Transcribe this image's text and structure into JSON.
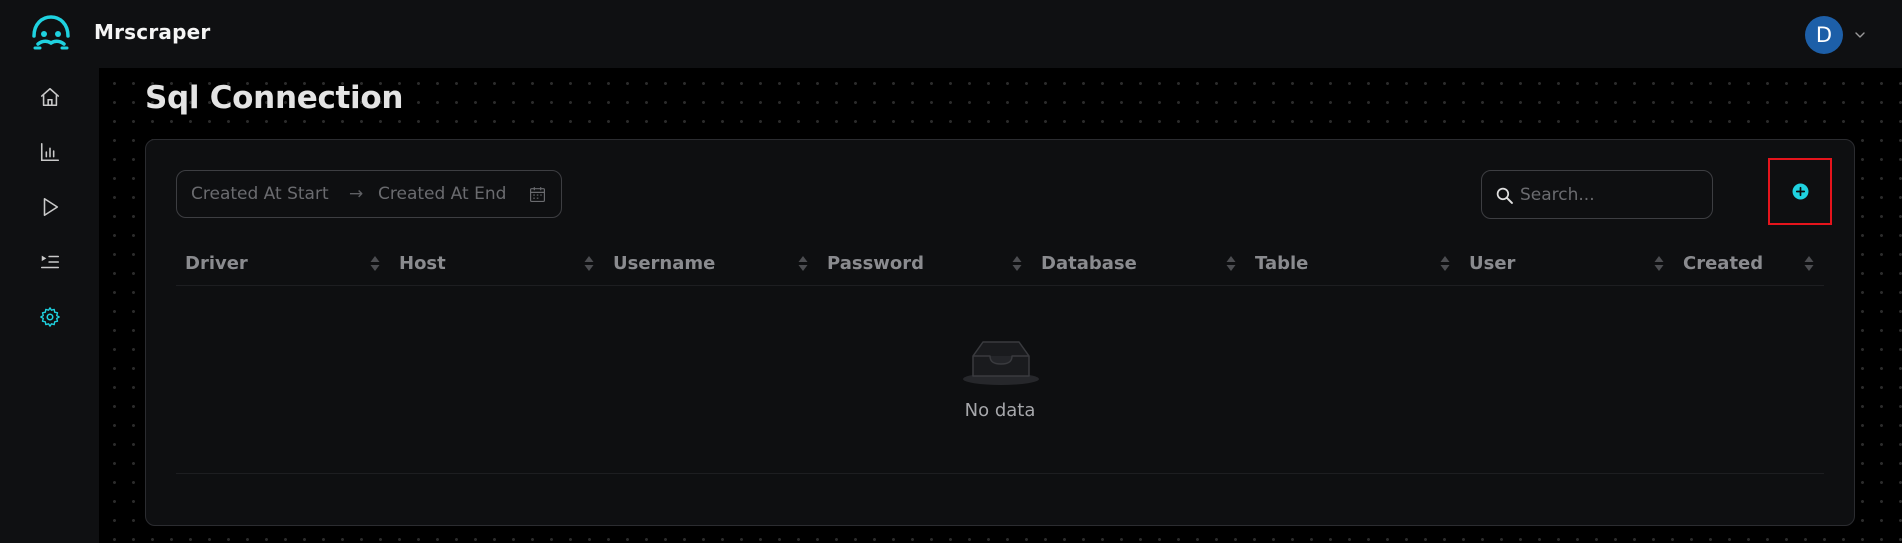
{
  "app": {
    "title": "Mrscraper"
  },
  "user": {
    "avatar_letter": "D"
  },
  "sidebar": {
    "items": [
      {
        "name": "home",
        "icon": "home-icon",
        "active": false
      },
      {
        "name": "analytics",
        "icon": "bar-chart-icon",
        "active": false
      },
      {
        "name": "run",
        "icon": "play-icon",
        "active": false
      },
      {
        "name": "queue",
        "icon": "playlist-icon",
        "active": false
      },
      {
        "name": "settings",
        "icon": "gear-icon",
        "active": true
      }
    ]
  },
  "page": {
    "title": "Sql Connection"
  },
  "filters": {
    "date_start_placeholder": "Created At Start",
    "date_arrow": "→",
    "date_end_placeholder": "Created At End",
    "search_placeholder": "Search..."
  },
  "table": {
    "columns": [
      "Driver",
      "Host",
      "Username",
      "Password",
      "Database",
      "Table",
      "User",
      "Created"
    ],
    "rows": [],
    "empty_text": "No data"
  },
  "colors": {
    "accent": "#1fd2e0",
    "avatar": "#1d5fa8",
    "highlight_border": "#e5141c"
  }
}
